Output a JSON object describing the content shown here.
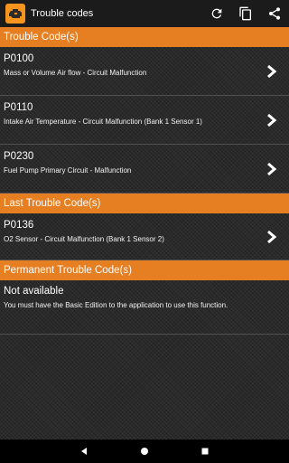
{
  "appbar": {
    "title": "Trouble codes",
    "icons": [
      "app-icon",
      "refresh-icon",
      "copy-icon",
      "share-icon"
    ]
  },
  "sections": {
    "current": {
      "header": "Trouble Code(s)",
      "items": [
        {
          "code": "P0100",
          "description": "Mass or Volume Air flow - Circuit Malfunction"
        },
        {
          "code": "P0110",
          "description": "Intake Air Temperature - Circuit Malfunction (Bank 1 Sensor 1)"
        },
        {
          "code": "P0230",
          "description": "Fuel Pump Primary Circuit - Malfunction"
        }
      ]
    },
    "last": {
      "header": "Last Trouble Code(s)",
      "items": [
        {
          "code": "P0136",
          "description": "O2 Sensor - Circuit Malfunction (Bank 1 Sensor 2)"
        }
      ]
    },
    "permanent": {
      "header": "Permanent Trouble Code(s)",
      "title": "Not available",
      "message": "You must have the Basic Edition to the application to use this function."
    }
  },
  "navbar": {
    "icons": [
      "back-icon",
      "home-icon",
      "recents-icon"
    ]
  },
  "colors": {
    "accent": "#e67e22",
    "appbar": "#1b1b1b",
    "navbar": "#000000",
    "text": "#ffffff"
  }
}
